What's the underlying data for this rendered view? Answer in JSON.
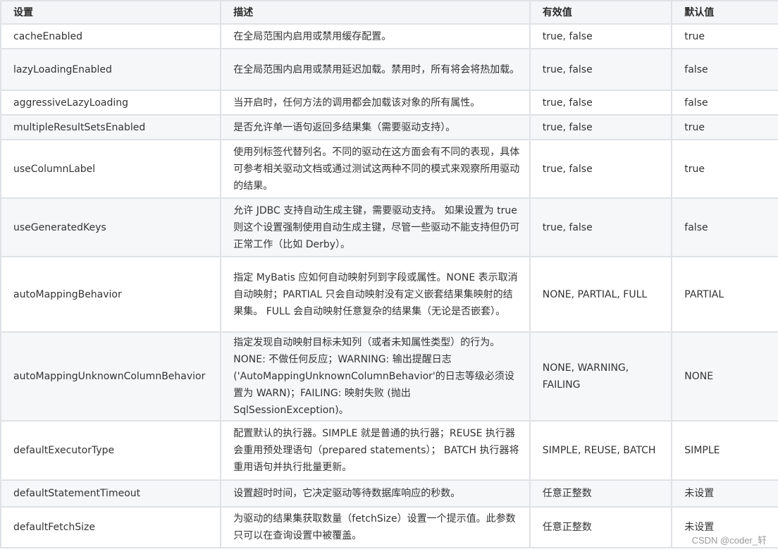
{
  "table": {
    "headers": {
      "setting": "设置",
      "description": "描述",
      "valid_values": "有效值",
      "default": "默认值"
    },
    "rows": [
      {
        "setting": "cacheEnabled",
        "description": "在全局范围内启用或禁用缓存配置。",
        "valid_values": "true, false",
        "default": "true",
        "height": 35
      },
      {
        "setting": "lazyLoadingEnabled",
        "description": "在全局范围内启用或禁用延迟加载。禁用时，所有将会将热加载。",
        "valid_values": "true, false",
        "default": "false",
        "height": 59
      },
      {
        "setting": "aggressiveLazyLoading",
        "description": "当开启时，任何方法的调用都会加载该对象的所有属性。",
        "valid_values": "true, false",
        "default": "false",
        "height": 35
      },
      {
        "setting": "multipleResultSetsEnabled",
        "description": "是否允许单一语句返回多结果集（需要驱动支持）。",
        "valid_values": "true, false",
        "default": "true",
        "height": 35
      },
      {
        "setting": "useColumnLabel",
        "description": "使用列标签代替列名。不同的驱动在这方面会有不同的表现，具体可参考相关驱动文档或通过测试这两种不同的模式来观察所用驱动的结果。",
        "valid_values": "true, false",
        "default": "true",
        "height": 83
      },
      {
        "setting": "useGeneratedKeys",
        "description": "允许 JDBC 支持自动生成主键，需要驱动支持。 如果设置为 true 则这个设置强制使用自动生成主键，尽管一些驱动不能支持但仍可正常工作（比如 Derby）。",
        "valid_values": "true, false",
        "default": "false",
        "height": 83
      },
      {
        "setting": "autoMappingBehavior",
        "description": "指定 MyBatis 应如何自动映射列到字段或属性。NONE 表示取消自动映射；PARTIAL 只会自动映射没有定义嵌套结果集映射的结果集。 FULL 会自动映射任意复杂的结果集（无论是否嵌套）。",
        "valid_values": "NONE, PARTIAL, FULL",
        "default": "PARTIAL",
        "height": 107
      },
      {
        "setting": "autoMappingUnknownColumnBehavior",
        "description": "指定发现自动映射目标未知列（或者未知属性类型）的行为。NONE: 不做任何反应；WARNING: 输出提醒日志 ('AutoMappingUnknownColumnBehavior'的日志等级必须设置为 WARN)；FAILING: 映射失败 (抛出 SqlSessionException)。",
        "valid_values": "NONE, WARNING, FAILING",
        "default": "NONE",
        "height": 126
      },
      {
        "setting": "defaultExecutorType",
        "description": "配置默认的执行器。SIMPLE 就是普通的执行器；REUSE 执行器会重用预处理语句（prepared statements）； BATCH 执行器将重用语句并执行批量更新。",
        "valid_values": "SIMPLE, REUSE, BATCH",
        "default": "SIMPLE",
        "height": 84
      },
      {
        "setting": "defaultStatementTimeout",
        "description": "设置超时时间，它决定驱动等待数据库响应的秒数。",
        "valid_values": "任意正整数",
        "default": "未设置",
        "height": 38
      },
      {
        "setting": "defaultFetchSize",
        "description": "为驱动的结果集获取数量（fetchSize）设置一个提示值。此参数只可以在查询设置中被覆盖。",
        "valid_values": "任意正整数",
        "default": "未设置",
        "height": 58
      }
    ]
  },
  "watermark": "CSDN @coder_轩"
}
